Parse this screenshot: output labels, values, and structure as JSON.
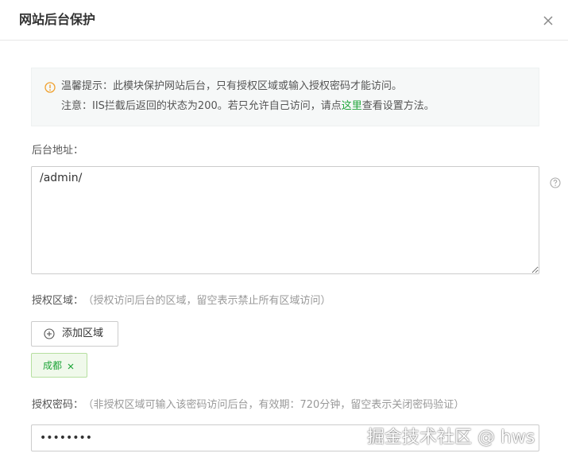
{
  "dialog": {
    "title": "网站后台保护",
    "close_icon": "close-icon"
  },
  "notice": {
    "icon": "warning-circle-icon",
    "line1": "温馨提示：此模块保护网站后台，只有授权区域或输入授权密码才能访问。",
    "line2_before": "注意：IIS拦截后返回的状态为200。若只允许自己访问，请点",
    "line2_link": "这里",
    "line2_after": "查看设置方法。",
    "link_color": "#20a53a"
  },
  "admin_path": {
    "label": "后台地址：",
    "value": "/admin/",
    "help_icon": "question-circle-icon"
  },
  "auth_region": {
    "label": "授权区域：",
    "hint": "（授权访问后台的区域，留空表示禁止所有区域访问）",
    "add_button_label": "添加区域",
    "add_icon": "plus-circle-icon",
    "tags": [
      {
        "label": "成都"
      }
    ]
  },
  "auth_password": {
    "label": "授权密码：",
    "hint": "（非授权区域可输入该密码访问后台，有效期：720分钟，留空表示关闭密码验证）",
    "value": "********"
  },
  "watermark": {
    "text": "掘金技术社区 @ hws"
  },
  "colors": {
    "accent": "#20a53a",
    "tag_bg": "#f0f9eb",
    "warning": "#f0a12f"
  }
}
